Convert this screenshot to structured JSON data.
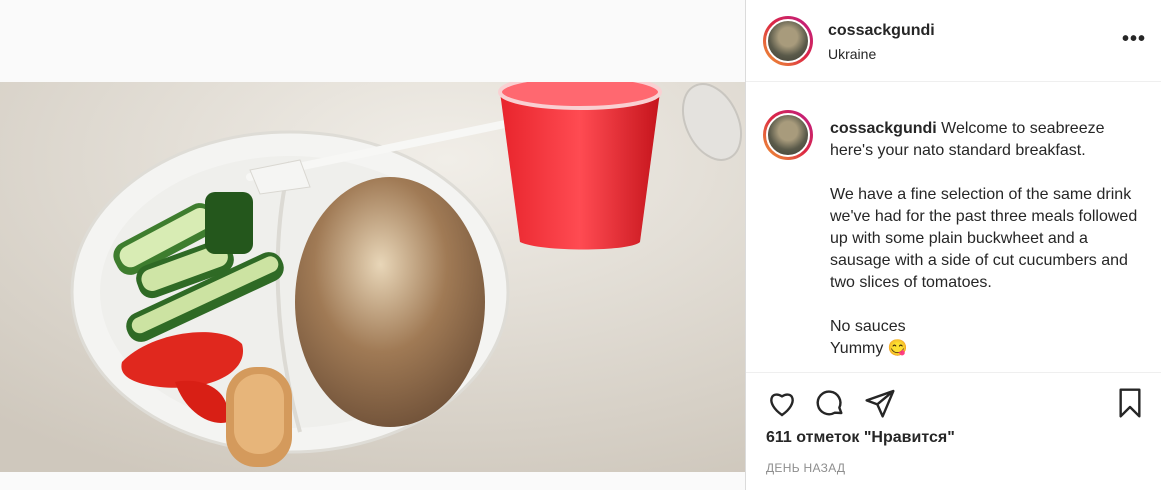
{
  "post": {
    "username": "cossackgundi",
    "location": "Ukraine",
    "more_icon": "ellipsis-horizontal-icon",
    "photo_alt": "plate-with-buckwheat-sausage-cucumbers-tomatoes-and-red-drink",
    "caption_username": "cossackgundi",
    "caption_text": " Welcome to seabreeze here's your nato standard breakfast.\n\nWe have a fine selection of the same drink we've had for the past three meals followed up with some plain buckwheet and a sausage with a side of cut cucumbers and two slices of tomatoes.\n\nNo sauces\nYummy 😋",
    "likes": "611 отметок \"Нравится\"",
    "date": "ДЕНЬ НАЗАД"
  },
  "icons": {
    "like": "heart-icon",
    "comment": "comment-icon",
    "share": "send-icon",
    "save": "bookmark-icon"
  },
  "colors": {
    "accent_gradient": [
      "#f09433",
      "#bc1888"
    ],
    "text": "#262626",
    "muted": "#8e8e8e"
  }
}
